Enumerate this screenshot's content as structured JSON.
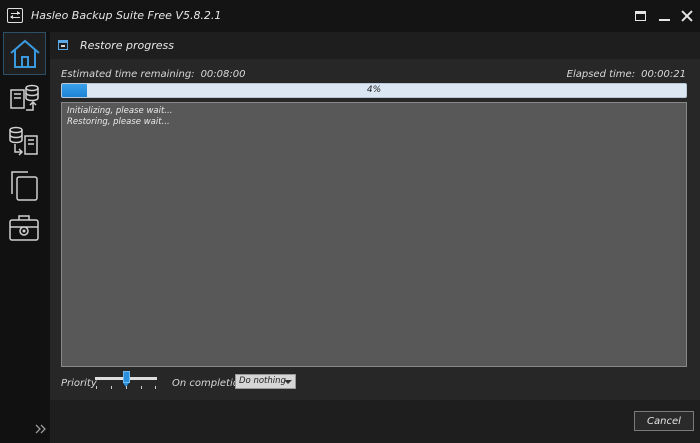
{
  "window": {
    "title": "Hasleo Backup Suite Free V5.8.2.1"
  },
  "sidebar": {
    "items": [
      {
        "icon": "home-icon",
        "active": true
      },
      {
        "icon": "backup-icon",
        "active": false
      },
      {
        "icon": "restore-icon",
        "active": false
      },
      {
        "icon": "clone-icon",
        "active": false
      },
      {
        "icon": "tools-icon",
        "active": false
      }
    ]
  },
  "header": {
    "title": "Restore progress"
  },
  "progress": {
    "estimated_label": "Estimated time remaining:",
    "estimated_value": "00:08:00",
    "elapsed_label": "Elapsed time:",
    "elapsed_value": "00:00:21",
    "percent_text": "4%",
    "percent": 4
  },
  "log": {
    "lines": [
      "Initializing, please wait...",
      "Restoring, please wait..."
    ]
  },
  "options": {
    "priority_label": "Priority",
    "priority_level": 0.5,
    "completion_label": "On completion",
    "completion_value": "Do nothing"
  },
  "footer": {
    "cancel_label": "Cancel"
  },
  "colors": {
    "accent": "#1c84d6",
    "progress_track": "#dbe8f4",
    "log_background": "#585858"
  }
}
